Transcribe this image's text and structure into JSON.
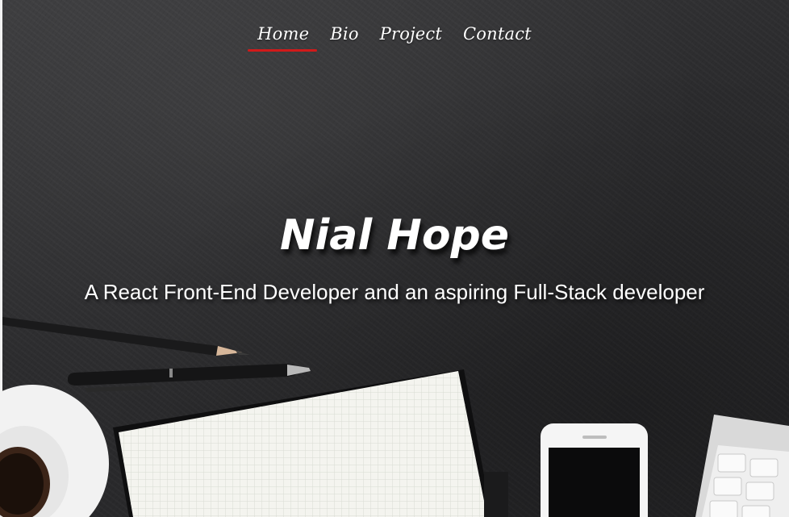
{
  "nav": {
    "items": [
      {
        "label": "Home",
        "active": true
      },
      {
        "label": "Bio",
        "active": false
      },
      {
        "label": "Project",
        "active": false
      },
      {
        "label": "Contact",
        "active": false
      }
    ],
    "active_color": "#d11a1a"
  },
  "hero": {
    "title": "Nial Hope",
    "subtitle": "A React Front-End Developer and an aspiring Full-Stack developer"
  },
  "background": {
    "base_color": "#2e2e30",
    "objects": [
      "pencil",
      "pen",
      "notebook",
      "coffee-cup",
      "smartphone",
      "keyboard"
    ]
  }
}
